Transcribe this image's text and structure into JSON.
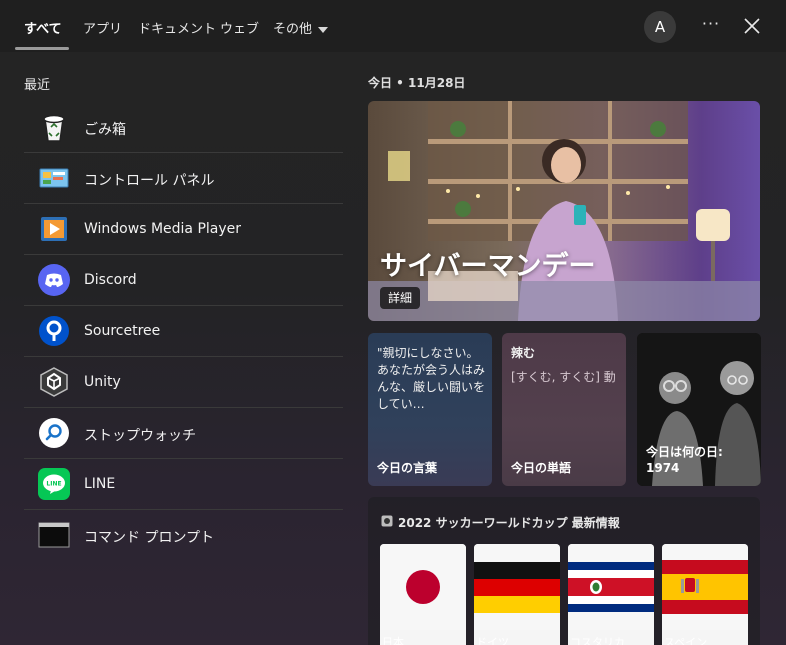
{
  "tabs": [
    {
      "label": "すべて"
    },
    {
      "label": "アプリ"
    },
    {
      "label": "ドキュメント"
    },
    {
      "label": "ウェブ"
    },
    {
      "label": "その他"
    }
  ],
  "account": {
    "initial": "A"
  },
  "more_label": "···",
  "recent": {
    "title": "最近",
    "items": [
      {
        "label": "ごみ箱",
        "icon": "recycle-bin-icon"
      },
      {
        "label": "コントロール パネル",
        "icon": "control-panel-icon"
      },
      {
        "label": "Windows Media Player",
        "icon": "media-player-icon"
      },
      {
        "label": "Discord",
        "icon": "discord-icon"
      },
      {
        "label": "Sourcetree",
        "icon": "sourcetree-icon"
      },
      {
        "label": "Unity",
        "icon": "unity-icon"
      },
      {
        "label": "ストップウォッチ",
        "icon": "stopwatch-icon"
      },
      {
        "label": "LINE",
        "icon": "line-icon"
      },
      {
        "label": "コマンド プロンプト",
        "icon": "command-prompt-icon"
      }
    ]
  },
  "today": {
    "header": "今日 • 11月28日",
    "hero": {
      "title": "サイバーマンデー",
      "button": "詳細"
    },
    "cards": [
      {
        "text": "\"親切にしなさい。あなたが会う人はみんな、厳しい闘いをしてい…",
        "title": "今日の言葉"
      },
      {
        "heading": "辣む",
        "text": "[すくむ, すくむ] 動",
        "title": "今日の単語"
      },
      {
        "title": "今日は何の日: 1974"
      }
    ]
  },
  "worldcup": {
    "title": "2022 サッカーワールドカップ 最新情報",
    "teams": [
      {
        "name": "日本"
      },
      {
        "name": "ドイツ"
      },
      {
        "name": "コスタリカ"
      },
      {
        "name": "スペイン"
      }
    ]
  },
  "colors": {
    "discord": "#5865F2",
    "sourcetree": "#0052CC",
    "line": "#06C755"
  }
}
